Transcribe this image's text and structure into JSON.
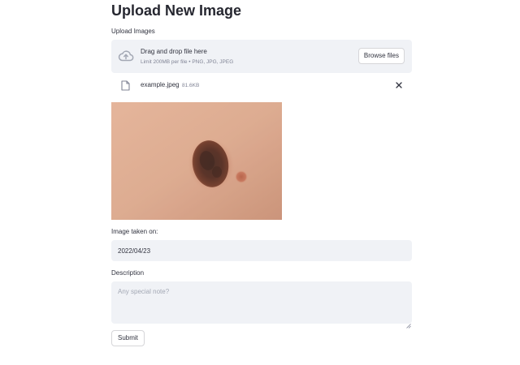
{
  "page": {
    "title": "Upload New Image"
  },
  "uploader": {
    "label": "Upload Images",
    "dropzone_title": "Drag and drop file here",
    "dropzone_subtitle": "Limit 200MB per file • PNG, JPG, JPEG",
    "browse_label": "Browse files",
    "icon": "cloud-upload-icon"
  },
  "uploaded_file": {
    "name": "example.jpeg",
    "size": "81.6KB",
    "icon": "file-icon",
    "remove_icon": "close-icon"
  },
  "preview": {
    "subject": "skin-mole-photo"
  },
  "date_field": {
    "label": "Image taken on:",
    "value": "2022/04/23"
  },
  "description_field": {
    "label": "Description",
    "placeholder": "Any special note?",
    "value": ""
  },
  "actions": {
    "submit_label": "Submit"
  },
  "colors": {
    "input_background": "#f0f2f6",
    "text": "#31333f",
    "muted_text": "#808495",
    "border": "#d6d6d9"
  }
}
